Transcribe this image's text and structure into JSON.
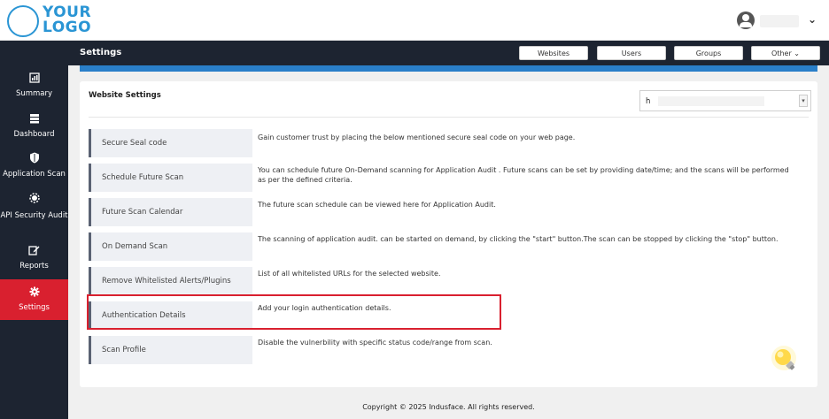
{
  "logo": {
    "line1": "YOUR",
    "line2": "LOGO"
  },
  "header": {
    "title": "Settings",
    "user_chevron": "⌄"
  },
  "top_tabs": [
    {
      "label": "Websites"
    },
    {
      "label": "Users"
    },
    {
      "label": "Groups"
    },
    {
      "label": "Other ⌄"
    }
  ],
  "sidebar": {
    "items": [
      {
        "label": "Summary",
        "icon": "summary-icon"
      },
      {
        "label": "Dashboard",
        "icon": "dashboard-icon"
      },
      {
        "label": "Application Scan",
        "icon": "shield-icon"
      },
      {
        "label": "API Security Audit",
        "icon": "api-icon"
      },
      {
        "label": "Reports",
        "icon": "edit-icon"
      },
      {
        "label": "Settings",
        "icon": "gear-icon",
        "active": true
      }
    ]
  },
  "card": {
    "title": "Website Settings",
    "select_value": "h"
  },
  "rows": [
    {
      "label": "Secure Seal code",
      "desc": "Gain customer trust by placing the below mentioned secure seal code on your web page."
    },
    {
      "label": "Schedule Future Scan",
      "desc": "You can schedule future On-Demand scanning for Application Audit . Future scans can be set by providing date/time; and the scans will be performed as per the defined criteria."
    },
    {
      "label": "Future Scan Calendar",
      "desc": "The future scan schedule can be viewed here for Application Audit."
    },
    {
      "label": "On Demand Scan",
      "desc": "The scanning of application audit. can be started on demand, by clicking the \"start\" button.The scan can be stopped by clicking the \"stop\" button."
    },
    {
      "label": "Remove Whitelisted Alerts/Plugins",
      "desc": "List of all whitelisted URLs for the selected website."
    },
    {
      "label": "Authentication Details",
      "desc": "Add your login authentication details."
    },
    {
      "label": "Scan Profile",
      "desc": "Disable the vulnerbility with specific status code/range from scan."
    }
  ],
  "footer": {
    "copyright": "Copyright © 2025 Indusface. All rights reserved."
  },
  "colors": {
    "sidebar": "#1d2431",
    "accent_red": "#d9202f",
    "accent_blue": "#2a7fc9"
  }
}
